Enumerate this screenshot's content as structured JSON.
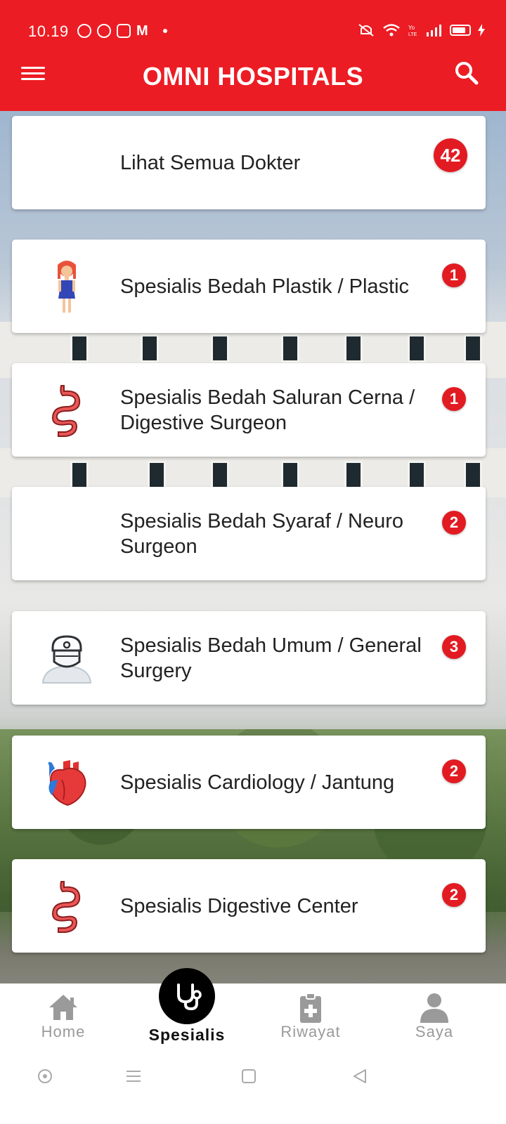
{
  "status_bar": {
    "time": "10.19"
  },
  "app_bar": {
    "title": "OMNI HOSPITALS"
  },
  "specialties": [
    {
      "label": "Lihat Semua Dokter",
      "count": "42",
      "icon": "none"
    },
    {
      "label": "Spesialis Bedah Plastik / Plastic",
      "count": "1",
      "icon": "woman-icon"
    },
    {
      "label": "Spesialis Bedah Saluran Cerna / Digestive Surgeon",
      "count": "1",
      "icon": "stomach-icon"
    },
    {
      "label": "Spesialis Bedah Syaraf / Neuro Surgeon",
      "count": "2",
      "icon": "none"
    },
    {
      "label": "Spesialis Bedah Umum / General Surgery",
      "count": "3",
      "icon": "surgeon-icon"
    },
    {
      "label": "Spesialis Cardiology / Jantung",
      "count": "2",
      "icon": "heart-icon"
    },
    {
      "label": "Spesialis Digestive Center",
      "count": "2",
      "icon": "stomach-icon"
    }
  ],
  "bottom_nav": {
    "home": "Home",
    "spesialis": "Spesialis",
    "riwayat": "Riwayat",
    "saya": "Saya"
  },
  "colors": {
    "primary": "#ec1c24",
    "badge": "#e21b22"
  }
}
